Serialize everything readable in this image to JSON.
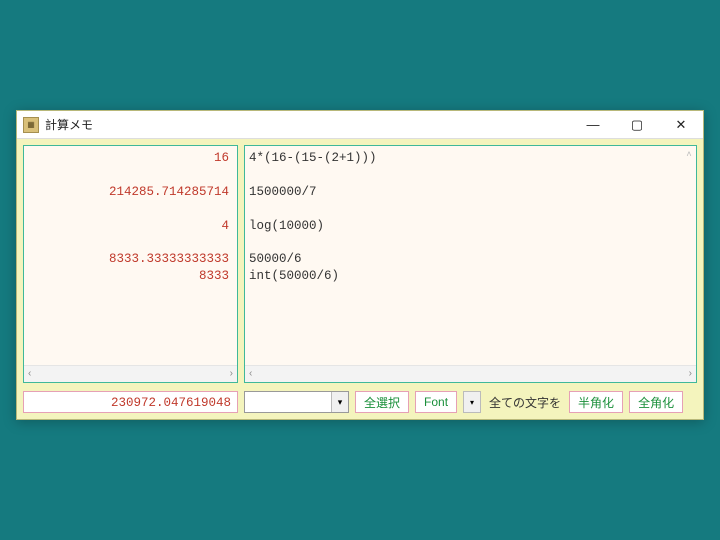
{
  "window": {
    "title": "計算メモ",
    "minimize": "—",
    "maximize": "▢",
    "close": "✕"
  },
  "results": {
    "r0": "16",
    "r1": "214285.714285714",
    "r2": "4",
    "r3": "8333.33333333333",
    "r4": "8333"
  },
  "expressions": {
    "e0": "4*(16-(15-(2+1)))",
    "e1": "1500000/7",
    "e2": "log(10000)",
    "e3": "50000/6",
    "e4": "int(50000/6)"
  },
  "total": "230972.047619048",
  "toolbar": {
    "combo_value": "",
    "select_all": "全選択",
    "font": "Font",
    "dropdown_glyph": "▾",
    "all_chars_label": "全ての文字を",
    "to_half": "半角化",
    "to_full": "全角化"
  },
  "scroll": {
    "left": "‹",
    "right": "›",
    "up": "˄"
  }
}
